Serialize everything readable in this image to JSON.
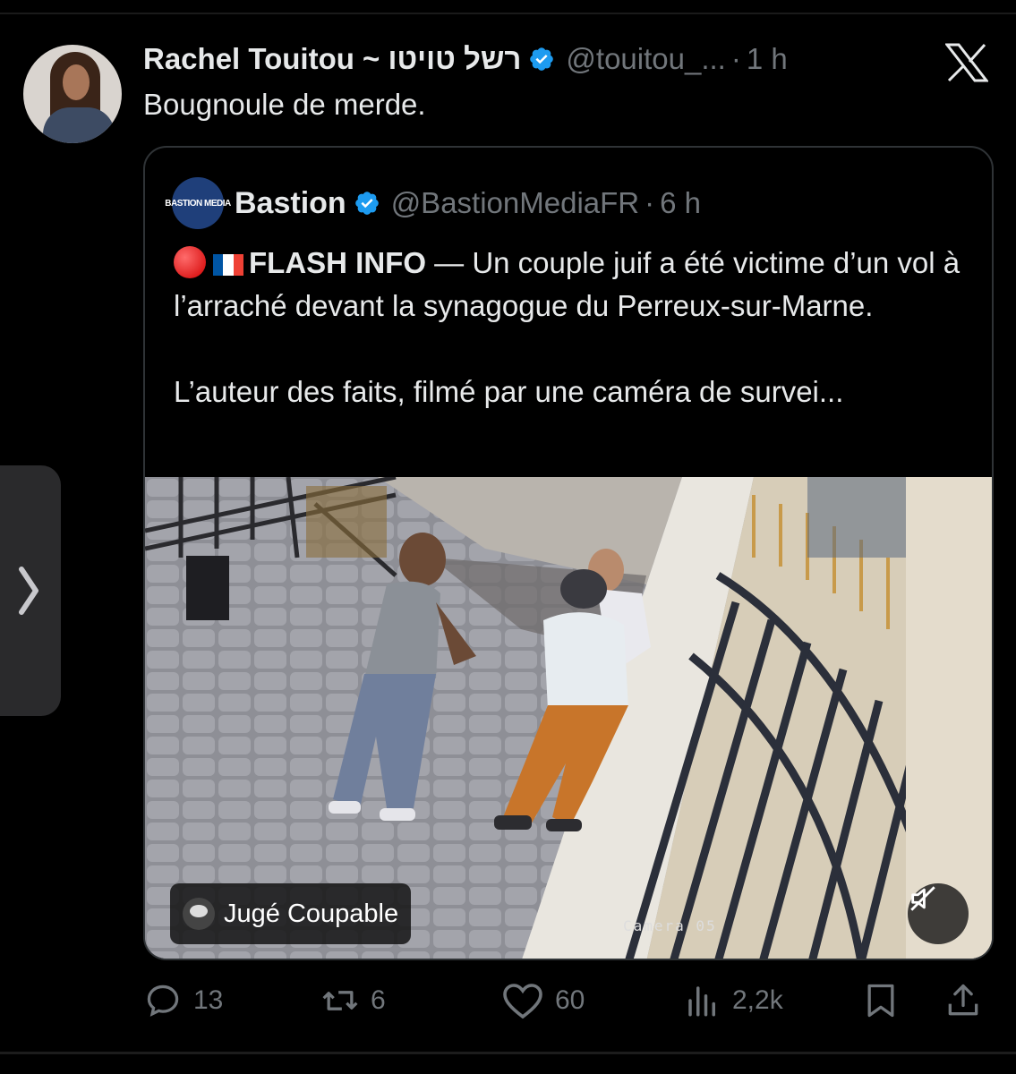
{
  "tweet": {
    "author_name": "Rachel Touitou ~ רשל טויטו",
    "handle": "@touitou_...",
    "separator": "·",
    "time": "1 h",
    "text": "Bougnoule de merde.",
    "verified_icon": "verified-badge-icon",
    "avatar_icon": "profile-photo"
  },
  "app": {
    "logo_icon": "x-logo-icon"
  },
  "quoted": {
    "logo_text": "BASTION MEDIA",
    "author_name": "Bastion",
    "handle": "@BastionMediaFR",
    "separator": "·",
    "time": "6 h",
    "flash_label": "FLASH INFO",
    "text_line1": " — Un couple juif a été victime d’un vol à l’arraché devant la synagogue du Perreux-sur-Marne.",
    "text_line2": "L’auteur des faits, filmé par une caméra de survei...",
    "media": {
      "pill_label": "Jugé Coupable",
      "camera_label": "Camera 05",
      "mute_icon": "muted-speaker-icon"
    }
  },
  "actions": {
    "replies": "13",
    "reposts": "6",
    "likes": "60",
    "views": "2,2k"
  },
  "side_tab": {
    "icon": "chevron-right-icon"
  }
}
